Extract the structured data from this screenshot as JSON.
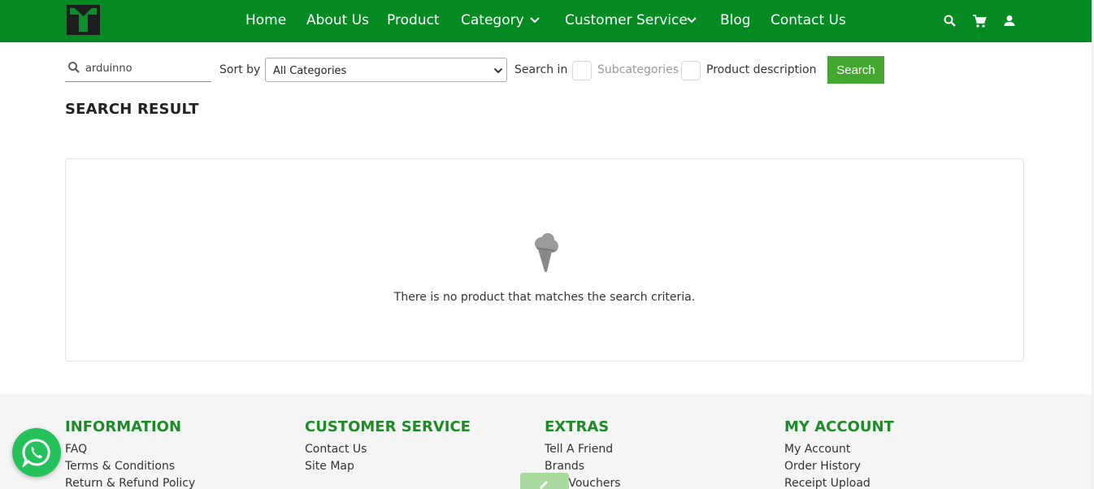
{
  "header": {
    "nav": [
      {
        "label": "Home"
      },
      {
        "label": "About Us"
      },
      {
        "label": "Product"
      },
      {
        "label": "Category",
        "has_dropdown": true
      },
      {
        "label": "Customer Service",
        "has_dropdown": true
      },
      {
        "label": "Blog"
      },
      {
        "label": "Contact Us"
      }
    ],
    "icons": [
      "search-icon",
      "cart-icon",
      "account-icon"
    ],
    "brand_color": "#038a22"
  },
  "search": {
    "query": "arduinno",
    "sort_label": "Sort by",
    "sort_value": "All Categories",
    "search_in_label": "Search in",
    "subcategories_label": "Subcategories",
    "subcategories_checked": false,
    "product_description_label": "Product description",
    "product_description_checked": false,
    "button_label": "Search",
    "button_color": "#44a72f"
  },
  "results": {
    "title": "SEARCH RESULT",
    "empty_message": "There is no product that matches the search criteria."
  },
  "footer": {
    "columns": [
      {
        "title": "INFORMATION",
        "links": [
          "FAQ",
          "Terms & Conditions",
          "Return & Refund Policy"
        ]
      },
      {
        "title": "CUSTOMER SERVICE",
        "links": [
          "Contact Us",
          "Site Map"
        ]
      },
      {
        "title": "EXTRAS",
        "links": [
          "Tell A Friend",
          "Brands",
          "Gift Vouchers"
        ]
      },
      {
        "title": "MY ACCOUNT",
        "links": [
          "My Account",
          "Order History",
          "Receipt Upload"
        ]
      }
    ],
    "title_color": "#1f8a2a"
  }
}
